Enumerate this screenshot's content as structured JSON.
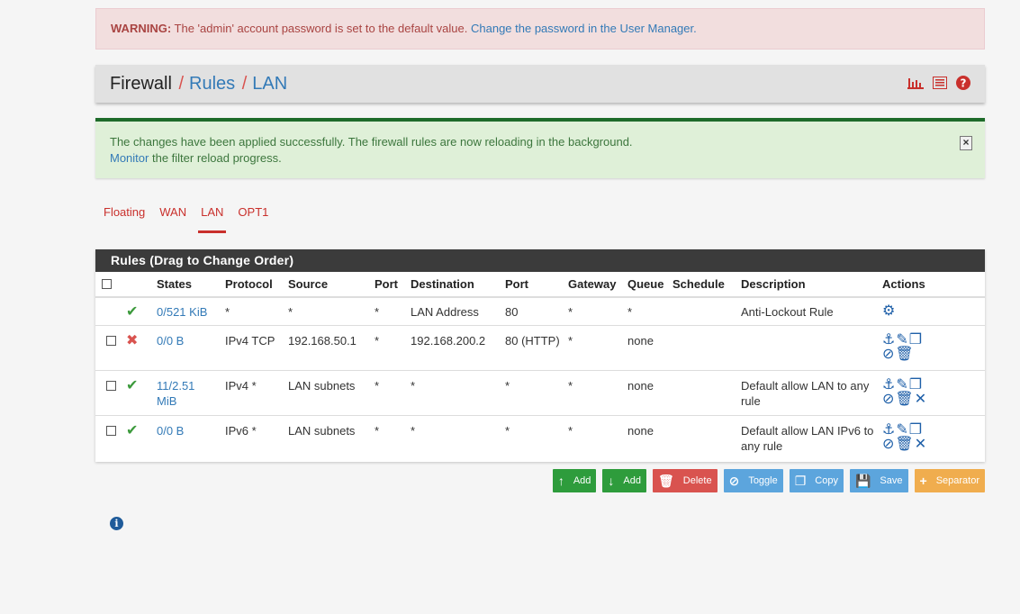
{
  "warning": {
    "label": "WARNING:",
    "text": " The 'admin' account password is set to the default value. ",
    "link": "Change the password in the User Manager."
  },
  "header": {
    "crumb1": "Firewall",
    "crumb2": "Rules",
    "crumb3": "LAN",
    "separator": "/",
    "icons": [
      "chart-icon",
      "list-icon",
      "help-icon"
    ]
  },
  "success": {
    "line1": "The changes have been applied successfully. The firewall rules are now reloading in the background.",
    "link": "Monitor",
    "line2": " the filter reload progress.",
    "close": "×"
  },
  "tabs": [
    "Floating",
    "WAN",
    "LAN",
    "OPT1"
  ],
  "active_tab": "LAN",
  "panel_title": "Rules (Drag to Change Order)",
  "columns": [
    "",
    "",
    "States",
    "Protocol",
    "Source",
    "Port",
    "Destination",
    "Port",
    "Gateway",
    "Queue",
    "Schedule",
    "Description",
    "Actions"
  ],
  "rows": [
    {
      "states": "0/521 KiB",
      "protocol": "*",
      "source": "*",
      "sport": "*",
      "destination": "LAN Address",
      "dport": "80",
      "gateway": "*",
      "queue": "*",
      "schedule": "",
      "description": "Anti-Lockout Rule"
    },
    {
      "states": "0/0 B",
      "protocol": "IPv4 TCP",
      "source": "192.168.50.1",
      "sport": "*",
      "destination": "192.168.200.2",
      "dport": "80 (HTTP)",
      "gateway": "*",
      "queue": "none",
      "schedule": "",
      "description": ""
    },
    {
      "states": "11/2.51 MiB",
      "protocol": "IPv4 *",
      "source": "LAN subnets",
      "sport": "*",
      "destination": "*",
      "dport": "*",
      "gateway": "*",
      "queue": "none",
      "schedule": "",
      "description": "Default allow LAN to any rule"
    },
    {
      "states": "0/0 B",
      "protocol": "IPv6 *",
      "source": "LAN subnets",
      "sport": "*",
      "destination": "*",
      "dport": "*",
      "gateway": "*",
      "queue": "none",
      "schedule": "",
      "description": "Default allow LAN IPv6 to any rule"
    }
  ],
  "buttons": {
    "add_top": "Add",
    "add_bottom": "Add",
    "delete": "Delete",
    "toggle": "Toggle",
    "copy": "Copy",
    "save": "Save",
    "separator": "Separator"
  },
  "colors": {
    "green": "#2e9c3c",
    "red": "#d9534f",
    "blue": "#5ca5dd",
    "orange": "#f0ad4e",
    "dark_header": "#3b3b3b"
  }
}
